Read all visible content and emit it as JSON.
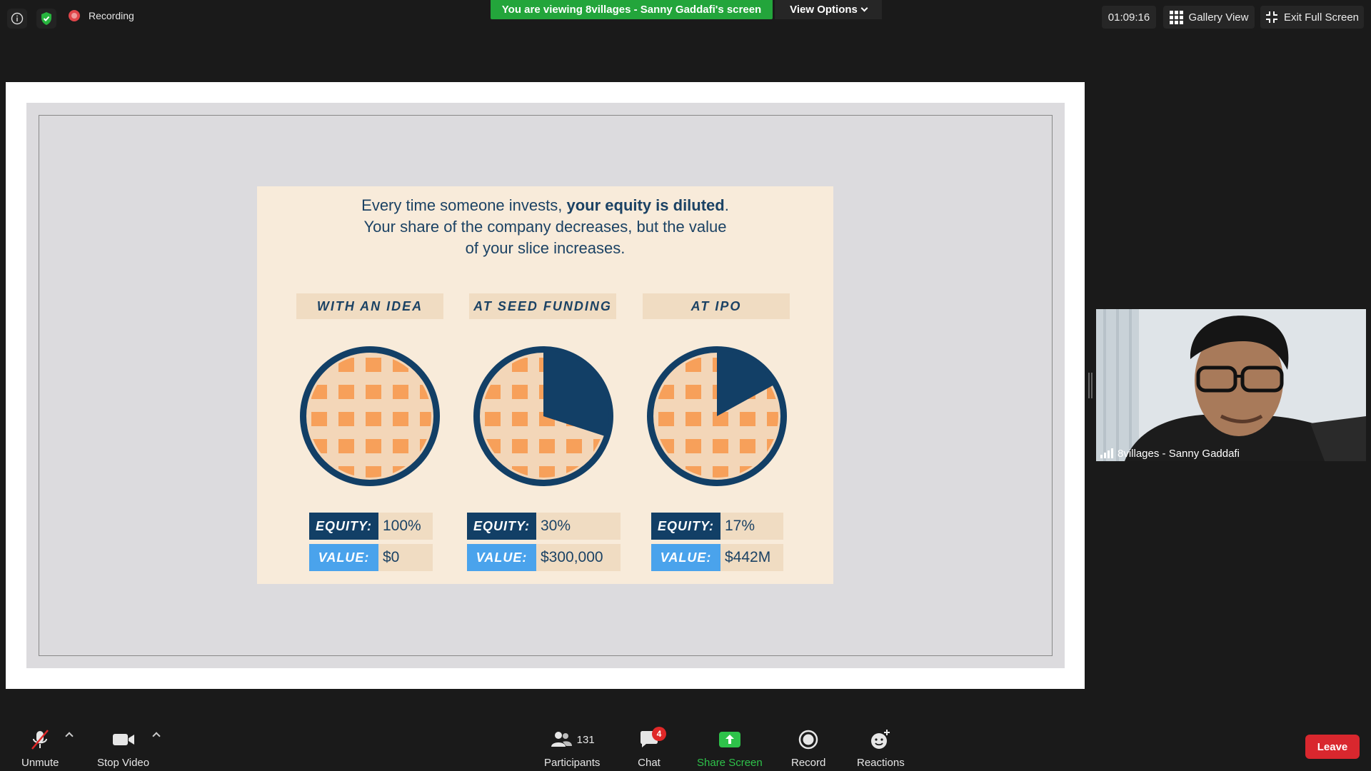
{
  "top_bar": {
    "recording_label": "Recording",
    "viewing_banner": "You are viewing 8villages - Sanny Gaddafi's screen",
    "view_options_label": "View Options",
    "timer": "01:09:16",
    "gallery_view_label": "Gallery View",
    "exit_full_screen_label": "Exit Full Screen"
  },
  "slide": {
    "headline_plain_1": "Every time someone invests, ",
    "headline_bold": "your equity is diluted",
    "headline_plain_2": ".",
    "headline_line_2": "Your share of the company decreases, but the value",
    "headline_line_3": "of your slice increases.",
    "stages": [
      {
        "label": "WITH AN IDEA",
        "equity_key": "EQUITY:",
        "equity": "100%",
        "value_key": "VALUE:",
        "value": "$0",
        "investor_share": 0
      },
      {
        "label": "AT SEED FUNDING",
        "equity_key": "EQUITY:",
        "equity": "30%",
        "value_key": "VALUE:",
        "value": "$300,000",
        "investor_share": 0.3
      },
      {
        "label": "AT IPO",
        "equity_key": "EQUITY:",
        "equity": "17%",
        "value_key": "VALUE:",
        "value": "$442M",
        "investor_share": 0.17
      }
    ],
    "colors": {
      "background": "#f8ebda",
      "navy": "#123f66",
      "light_blue": "#4aa3ec",
      "crust": "#f3d6b8",
      "squares": "#f7a05a"
    }
  },
  "participant": {
    "name": "8villages - Sanny Gaddafi"
  },
  "toolbar": {
    "unmute_label": "Unmute",
    "stop_video_label": "Stop Video",
    "participants_count": "131",
    "participants_label": "Participants",
    "chat_label": "Chat",
    "chat_badge": "4",
    "share_screen_label": "Share Screen",
    "record_label": "Record",
    "reactions_label": "Reactions",
    "leave_label": "Leave"
  },
  "icons": [
    "info-icon",
    "shield-check-icon",
    "recording-icon",
    "gallery-grid-icon",
    "exit-fullscreen-icon",
    "signal-icon",
    "mic-muted-icon",
    "video-camera-icon",
    "participants-icon",
    "chat-icon",
    "share-screen-icon",
    "record-icon",
    "reactions-icon"
  ]
}
